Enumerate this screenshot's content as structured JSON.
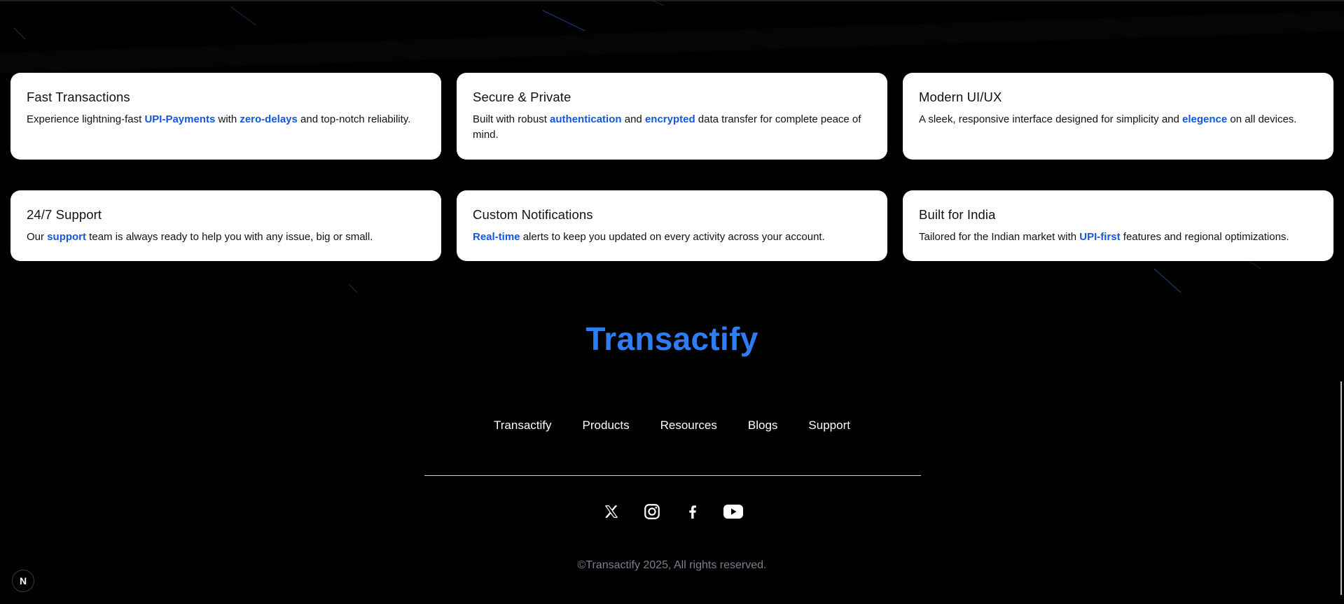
{
  "features": [
    {
      "title": "Fast Transactions",
      "parts": [
        {
          "text": "Experience lightning-fast ",
          "hl": false
        },
        {
          "text": "UPI-Payments",
          "hl": true
        },
        {
          "text": " with ",
          "hl": false
        },
        {
          "text": "zero-delays",
          "hl": true
        },
        {
          "text": " and top-notch reliability.",
          "hl": false
        }
      ]
    },
    {
      "title": "Secure & Private",
      "parts": [
        {
          "text": "Built with robust ",
          "hl": false
        },
        {
          "text": "authentication",
          "hl": true
        },
        {
          "text": " and ",
          "hl": false
        },
        {
          "text": "encrypted",
          "hl": true
        },
        {
          "text": " data transfer for complete peace of mind.",
          "hl": false
        }
      ]
    },
    {
      "title": "Modern UI/UX",
      "parts": [
        {
          "text": "A sleek, responsive interface designed for simplicity and ",
          "hl": false
        },
        {
          "text": "elegence",
          "hl": true
        },
        {
          "text": " on all devices.",
          "hl": false
        }
      ]
    },
    {
      "title": "24/7 Support",
      "parts": [
        {
          "text": "Our ",
          "hl": false
        },
        {
          "text": "support",
          "hl": true
        },
        {
          "text": " team is always ready to help you with any issue, big or small.",
          "hl": false
        }
      ]
    },
    {
      "title": "Custom Notifications",
      "parts": [
        {
          "text": "Real-time",
          "hl": true
        },
        {
          "text": " alerts to keep you updated on every activity across your account.",
          "hl": false
        }
      ]
    },
    {
      "title": "Built for India",
      "parts": [
        {
          "text": "Tailored for the Indian market with ",
          "hl": false
        },
        {
          "text": "UPI-first",
          "hl": true
        },
        {
          "text": " features and regional optimizations.",
          "hl": false
        }
      ]
    }
  ],
  "footer": {
    "brand": "Transactify",
    "nav": [
      "Transactify",
      "Products",
      "Resources",
      "Blogs",
      "Support"
    ],
    "socials": [
      "x-icon",
      "instagram-icon",
      "facebook-icon",
      "youtube-icon"
    ],
    "copyright": "©Transactify 2025, All rights reserved."
  },
  "dev_badge": "N",
  "colors": {
    "background": "#000000",
    "brand": "#2d7df4",
    "highlight": "#1557d8",
    "card": "#ffffff",
    "muted_text": "#7a7f8c"
  }
}
